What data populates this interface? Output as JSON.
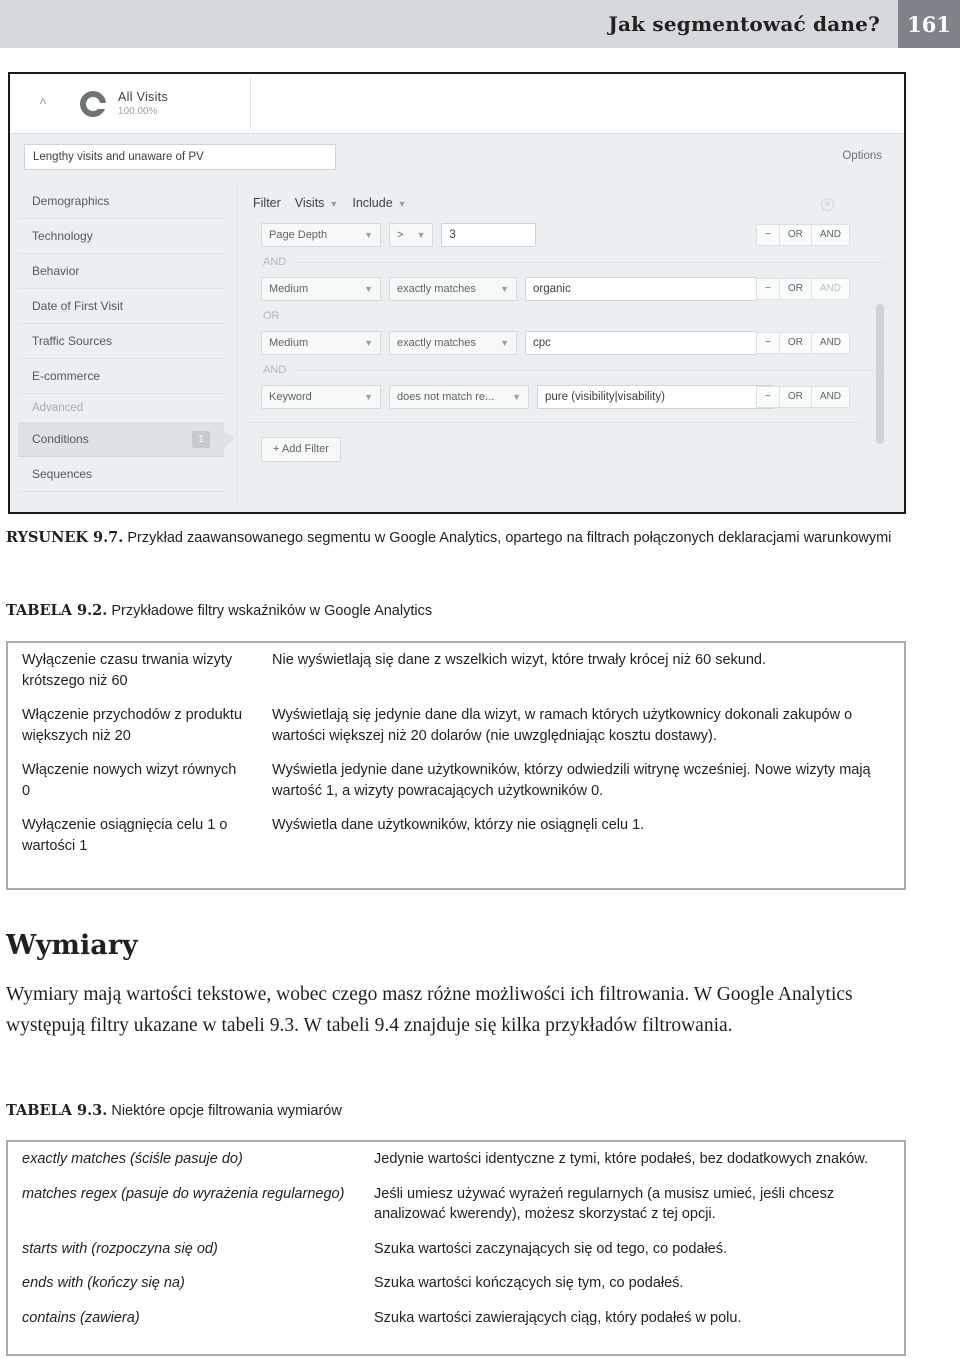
{
  "runhead": {
    "title": "Jak segmentować dane?",
    "page_number": "161"
  },
  "screenshot": {
    "all_visits": {
      "name": "All Visits",
      "percent": "100.00%"
    },
    "segment_name_value": "Lengthy visits and unaware of PV",
    "options_label": "Options",
    "nav": [
      {
        "label": "Demographics",
        "type": "item"
      },
      {
        "label": "Technology",
        "type": "item"
      },
      {
        "label": "Behavior",
        "type": "item"
      },
      {
        "label": "Date of First Visit",
        "type": "item"
      },
      {
        "label": "Traffic Sources",
        "type": "item"
      },
      {
        "label": "E-commerce",
        "type": "item"
      },
      {
        "label": "Advanced",
        "type": "section"
      },
      {
        "label": "Conditions",
        "type": "item",
        "active": true,
        "badge": "1"
      },
      {
        "label": "Sequences",
        "type": "item"
      }
    ],
    "filter_header": {
      "filter_label": "Filter",
      "scope_value": "Visits",
      "mode_value": "Include"
    },
    "conditions": [
      {
        "dimension": "Page Depth",
        "operator": ">",
        "value": "3",
        "logic": [
          "−",
          "OR",
          "AND"
        ],
        "logic_dim": [
          false,
          false,
          false
        ]
      },
      {
        "dimension": "Medium",
        "operator": "exactly matches",
        "value": "organic",
        "logic": [
          "−",
          "OR",
          "AND"
        ],
        "logic_dim": [
          false,
          false,
          true
        ]
      },
      {
        "dimension": "Medium",
        "operator": "exactly matches",
        "value": "cpc",
        "logic": [
          "−",
          "OR",
          "AND"
        ],
        "logic_dim": [
          false,
          false,
          false
        ]
      },
      {
        "dimension": "Keyword",
        "operator": "does not match re...",
        "value": "pure (visibility|visability)",
        "logic": [
          "−",
          "OR",
          "AND"
        ],
        "logic_dim": [
          false,
          false,
          false
        ]
      }
    ],
    "connectors": {
      "and": "AND",
      "or": "OR"
    },
    "add_filter_label": "+ Add Filter"
  },
  "figure_caption": {
    "number": "RYSUNEK 9.7.",
    "text": " Przykład zaawansowanego segmentu w Google Analytics, opartego na filtrach połączonych deklaracjami warunkowymi"
  },
  "table_92": {
    "caption_number": "TABELA 9.2.",
    "caption_text": " Przykładowe filtry wskaźników w Google Analytics",
    "rows": [
      {
        "left": "Wyłączenie czasu trwania wizyty krótszego niż 60",
        "right": "Nie wyświetlają się dane z wszelkich wizyt, które trwały krócej niż 60 sekund."
      },
      {
        "left": "Włączenie przychodów z produktu większych niż 20",
        "right": "Wyświetlają się jedynie dane dla wizyt, w ramach których użytkownicy dokonali zakupów o wartości większej niż 20 dolarów (nie uwzględniając kosztu dostawy)."
      },
      {
        "left": "Włączenie nowych wizyt równych 0",
        "right": "Wyświetla jedynie dane użytkowników, którzy odwiedzili witrynę wcześniej. Nowe wizyty mają wartość 1, a wizyty powracających użytkowników 0."
      },
      {
        "left": "Wyłączenie osiągnięcia celu 1 o wartości 1",
        "right": "Wyświetla dane użytkowników, którzy nie osiągnęli celu 1."
      }
    ]
  },
  "section": {
    "heading": "Wymiary",
    "paragraph": "Wymiary mają wartości tekstowe, wobec czego masz różne możliwości ich filtrowania. W Google Analytics występują filtry ukazane w tabeli 9.3. W tabeli 9.4 znajduje się kilka przykładów filtrowania."
  },
  "table_93": {
    "caption_number": "TABELA 9.3.",
    "caption_text": " Niektóre opcje filtrowania wymiarów",
    "rows": [
      {
        "left": "exactly matches (ściśle pasuje do)",
        "right": "Jedynie wartości identyczne z tymi, które podałeś, bez dodatkowych znaków."
      },
      {
        "left": "matches regex (pasuje do wyrażenia regularnego)",
        "right": "Jeśli umiesz używać wyrażeń regularnych (a musisz umieć, jeśli chcesz analizować kwerendy), możesz skorzystać z tej opcji."
      },
      {
        "left": "starts with (rozpoczyna się od)",
        "right": "Szuka wartości zaczynających się od tego, co podałeś."
      },
      {
        "left": "ends with (kończy się na)",
        "right": "Szuka wartości kończących się tym, co podałeś."
      },
      {
        "left": "contains (zawiera)",
        "right": "Szuka wartości zawierających ciąg, który podałeś w polu."
      }
    ]
  }
}
